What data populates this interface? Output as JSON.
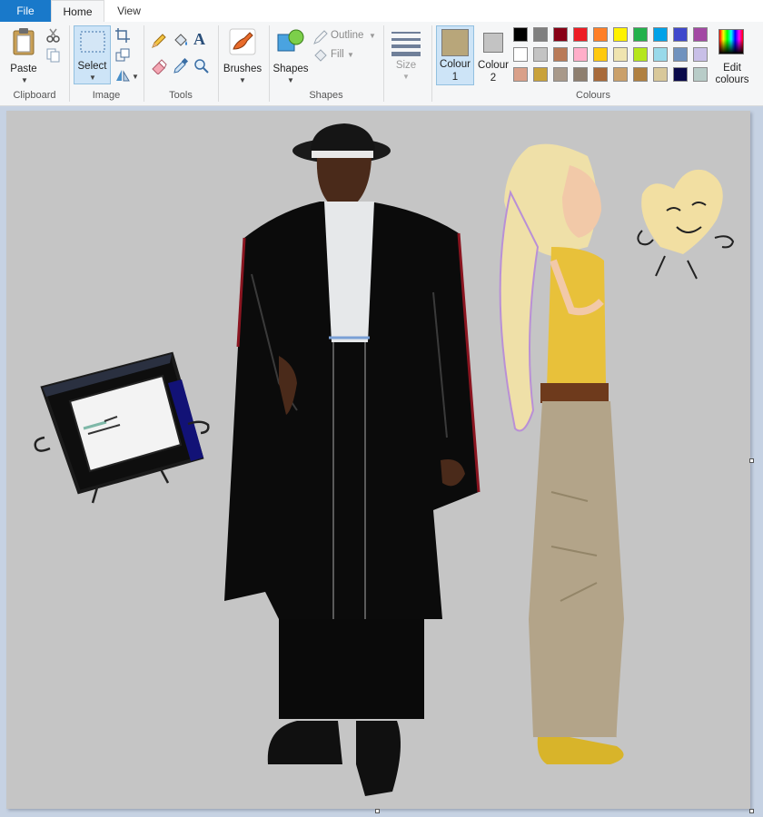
{
  "tabs": {
    "file": "File",
    "home": "Home",
    "view": "View"
  },
  "clipboard": {
    "paste": "Paste",
    "group": "Clipboard"
  },
  "image": {
    "select": "Select",
    "group": "Image"
  },
  "tools": {
    "group": "Tools"
  },
  "brushes": {
    "label": "Brushes"
  },
  "shapes": {
    "label": "Shapes",
    "outline": "Outline",
    "fill": "Fill",
    "group": "Shapes"
  },
  "size": {
    "label": "Size"
  },
  "colours": {
    "colour1_label": "Colour",
    "colour1_num": "1",
    "colour2_label": "Colour",
    "colour2_num": "2",
    "edit_line1": "Edit",
    "edit_line2": "colours",
    "group": "Colours",
    "colour1": "#b8a67a",
    "colour2": "#c3c3c3",
    "palette_row1": [
      "#000000",
      "#7f7f7f",
      "#880015",
      "#ed1c24",
      "#ff7f27",
      "#fff200",
      "#22b14c",
      "#00a2e8",
      "#3f48cc",
      "#a349a4"
    ],
    "palette_row2": [
      "#ffffff",
      "#c3c3c3",
      "#b97a57",
      "#ffaec9",
      "#ffc90e",
      "#efe4b0",
      "#b5e61d",
      "#99d9ea",
      "#7092be",
      "#c8bfe7"
    ],
    "palette_row3": [
      "#d9a089",
      "#c9a23a",
      "#a8998a",
      "#8e7f6f",
      "#a86a3a",
      "#caa06a",
      "#b08040",
      "#d8c89a",
      "#0a0a4a",
      "#b8ccc8"
    ]
  },
  "canvas": {
    "background": "#c5c5c5"
  }
}
